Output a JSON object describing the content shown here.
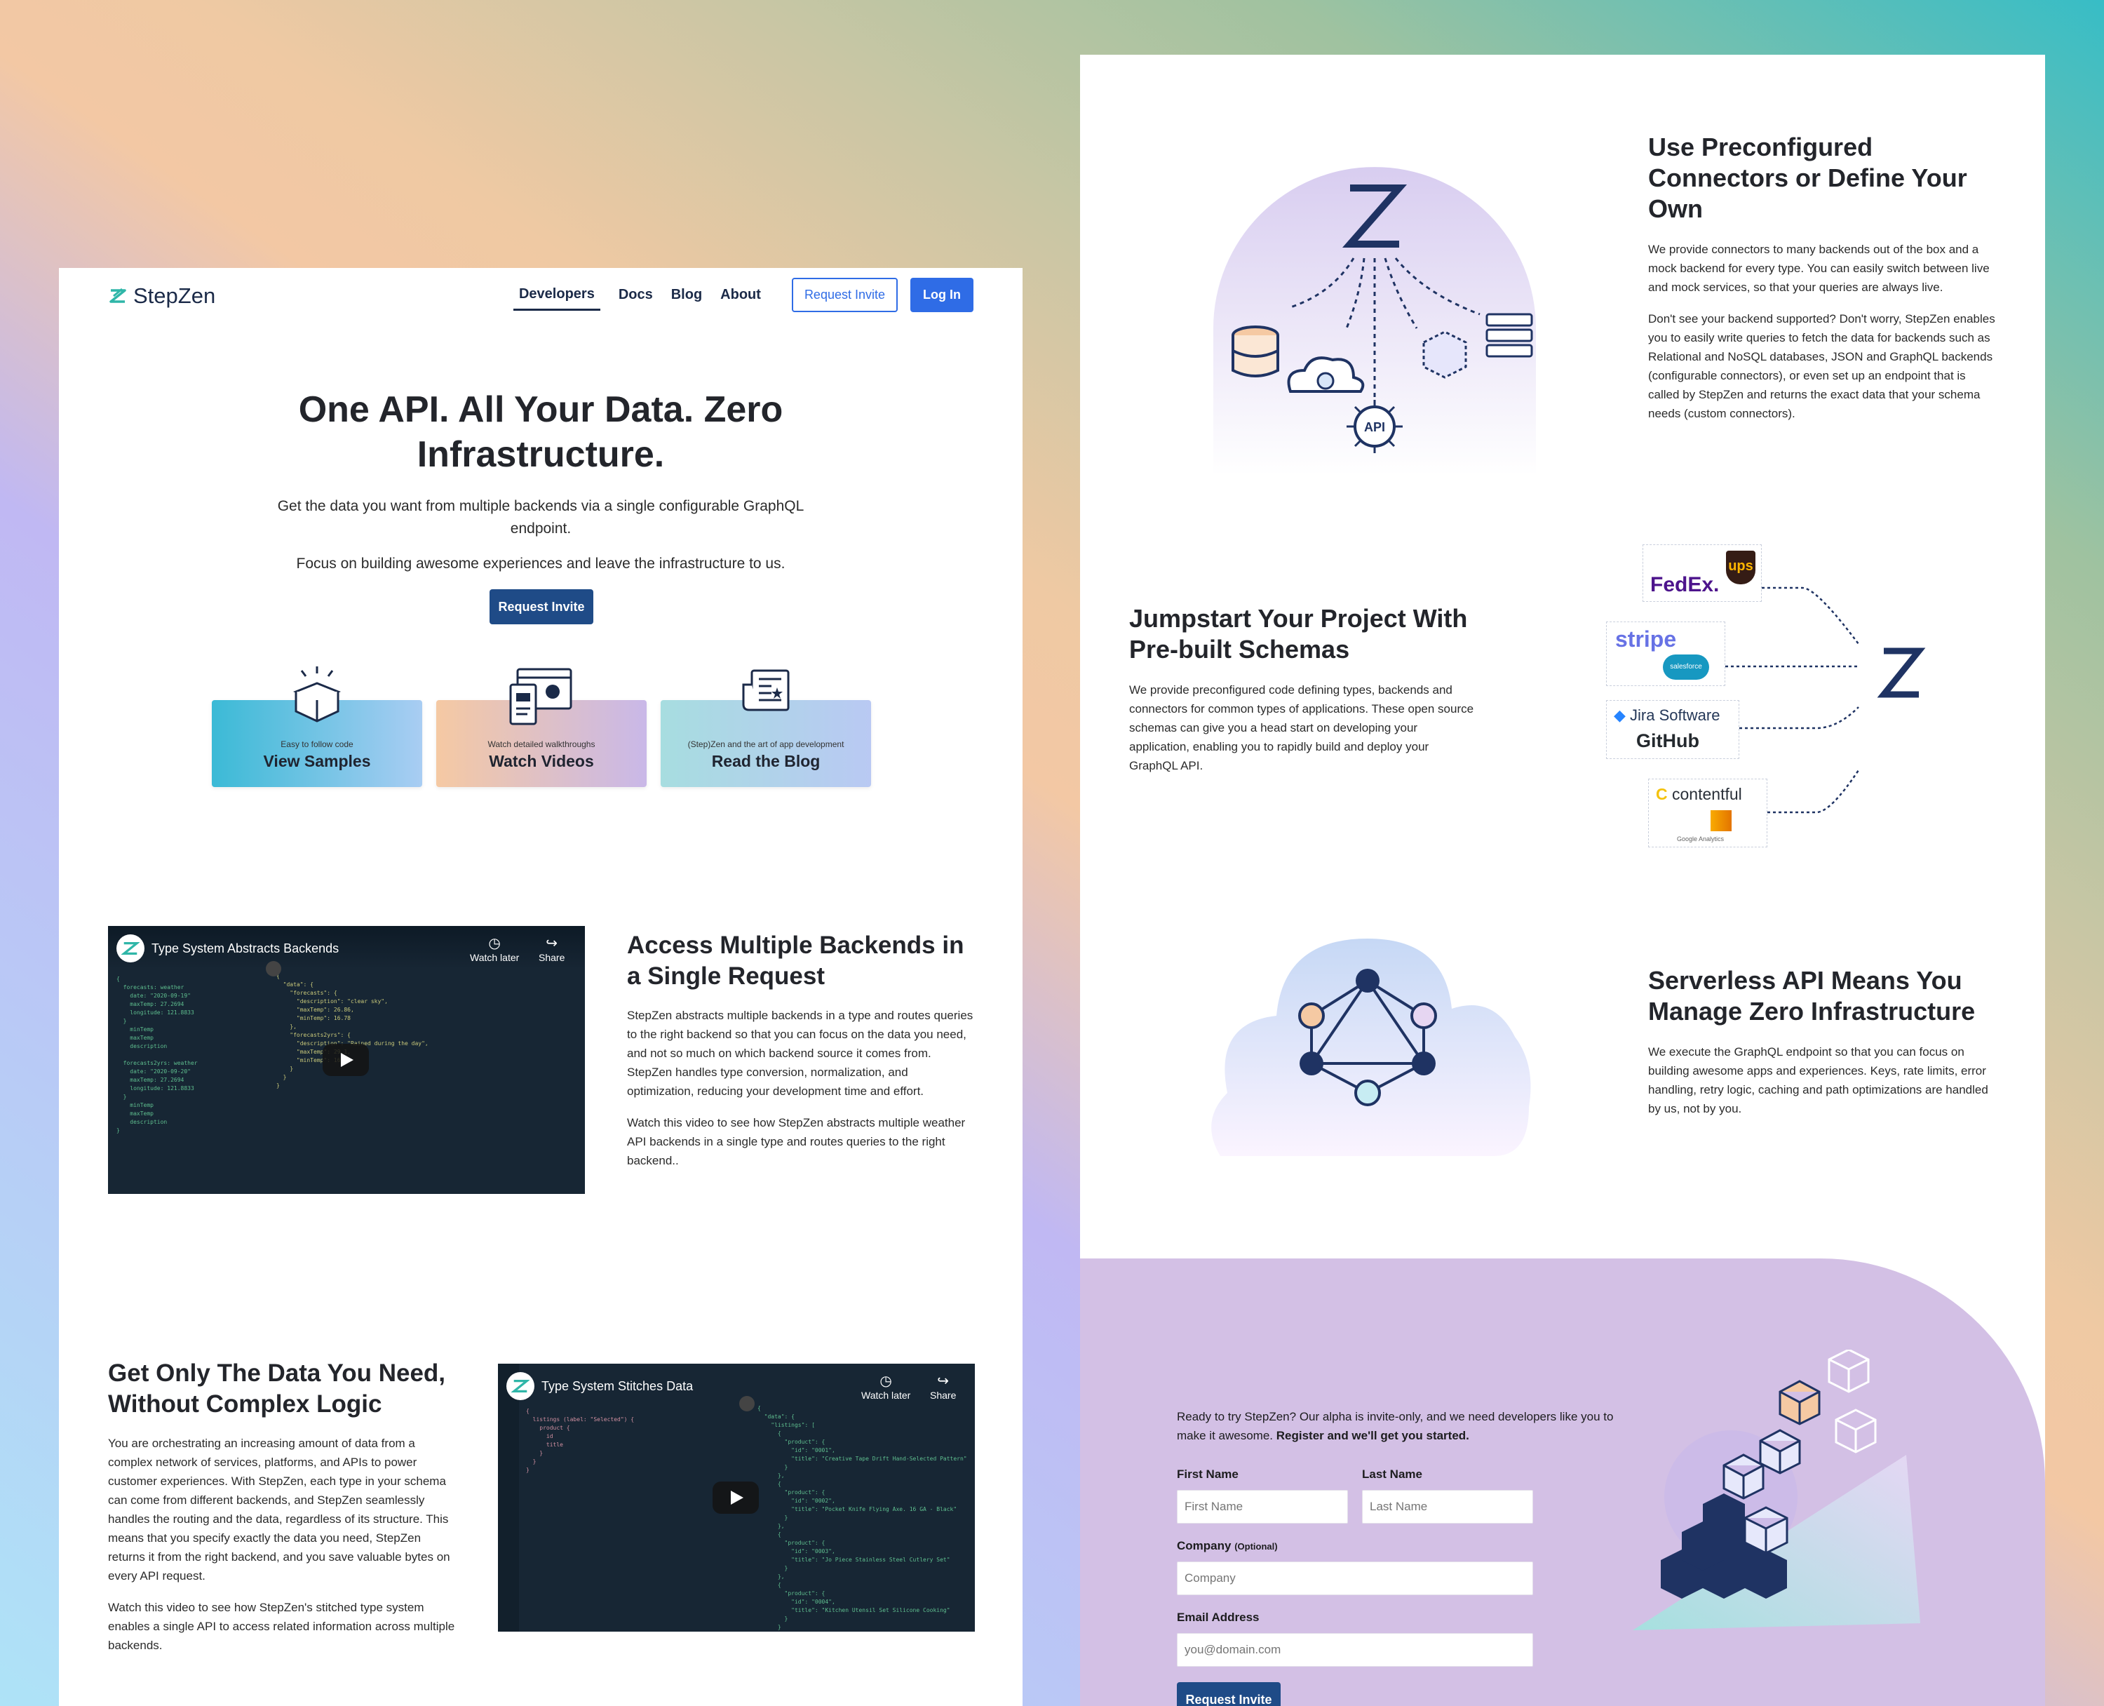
{
  "nav": {
    "brand": "StepZen",
    "links": [
      "Developers",
      "Docs",
      "Blog",
      "About"
    ],
    "request_invite": "Request Invite",
    "login": "Log In"
  },
  "hero": {
    "title": "One API. All Your Data. Zero Infrastructure.",
    "subtitle": "Get the data you want from multiple backends via a single configurable GraphQL endpoint.",
    "subtitle2": "Focus on building awesome experiences and leave the infrastructure to us.",
    "cta": "Request Invite"
  },
  "cards": [
    {
      "small": "Easy to follow code",
      "big": "View Samples"
    },
    {
      "small": "Watch detailed walkthroughs",
      "big": "Watch Videos"
    },
    {
      "small": "(Step)Zen and the art of app development",
      "big": "Read the Blog"
    }
  ],
  "video1": {
    "title": "Type System Abstracts Backends",
    "watch_later": "Watch later",
    "share": "Share"
  },
  "video2": {
    "title": "Type System Stitches Data",
    "watch_later": "Watch later",
    "share": "Share"
  },
  "section_access": {
    "title": "Access Multiple Backends in a Single Request",
    "p1": "StepZen abstracts multiple backends in a type and routes queries to the right backend so that you can focus on the data you need, and not so much on which backend source it comes from. StepZen handles type conversion, normalization, and optimization, reducing your development time and effort.",
    "p2": "Watch this video to see how StepZen abstracts multiple weather API backends in a single type and routes queries to the right backend.."
  },
  "section_data": {
    "title": "Get Only The Data You Need, Without Complex Logic",
    "p1": "You are orchestrating an increasing amount of data from a complex network of services, platforms, and APIs to power customer experiences. With StepZen, each type in your schema can come from different backends, and StepZen seamlessly handles the routing and the data, regardless of its structure. This means that you specify exactly the data you need, StepZen returns it from the right backend, and you save valuable bytes on every API request.",
    "p2": "Watch this video to see how StepZen's stitched type system enables a single API to access related information across multiple backends."
  },
  "section_connectors": {
    "title": "Use Preconfigured Connectors or Define Your Own",
    "p1": "We provide connectors to many backends out of the box and a mock backend for every type. You can easily switch between live and mock services, so that your queries are always live.",
    "p2": "Don't see your backend supported? Don't worry, StepZen enables you to easily write queries to fetch the data for backends such as Relational and NoSQL databases, JSON and GraphQL backends (configurable connectors), or even set up an endpoint that is called by StepZen and returns the exact data that your schema needs (custom connectors).",
    "api_label": "API"
  },
  "section_schemas": {
    "title": "Jumpstart Your Project With Pre-built Schemas",
    "p1": "We provide preconfigured code defining types, backends and connectors for common types of applications. These open source schemas can give you a head start on developing your application, enabling you to rapidly build and deploy your GraphQL API.",
    "logos": [
      "FedEx.",
      "ups",
      "stripe",
      "salesforce",
      "Jira Software",
      "GitHub",
      "contentful",
      "Google Analytics"
    ]
  },
  "section_serverless": {
    "title": "Serverless API Means You Manage Zero Infrastructure",
    "p1": "We execute the GraphQL endpoint so that you can focus on building awesome apps and experiences. Keys, rate limits, error handling, retry logic, caching and path optimizations are handled by us, not by you."
  },
  "signup": {
    "intro": "Ready to try StepZen? Our alpha is invite-only, and we need developers like you to make it awesome.",
    "intro_bold": "Register and we'll get you started.",
    "first_name_label": "First Name",
    "first_name_placeholder": "First Name",
    "last_name_label": "Last Name",
    "last_name_placeholder": "Last Name",
    "company_label": "Company",
    "company_optional": "(Optional)",
    "company_placeholder": "Company",
    "email_label": "Email Address",
    "email_placeholder": "you@domain.com",
    "submit": "Request Invite"
  },
  "colors": {
    "accent_blue": "#2f6ce6",
    "dark_navy": "#1b2a48",
    "button_dark": "#1f4b87",
    "cta_bg": "#d3c0e5"
  }
}
